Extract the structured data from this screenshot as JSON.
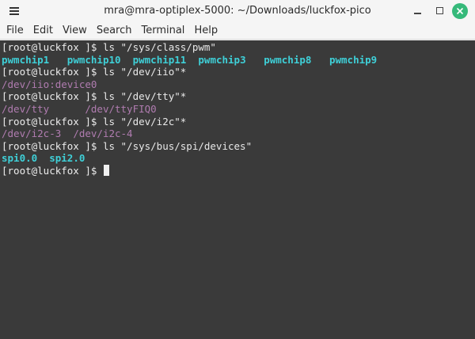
{
  "window": {
    "title": "mra@mra-optiplex-5000: ~/Downloads/luckfox-pico",
    "accent_close": "#35b97a"
  },
  "menu": {
    "items": [
      "File",
      "Edit",
      "View",
      "Search",
      "Terminal",
      "Help"
    ]
  },
  "terminal": {
    "prompt": "[root@luckfox ]$",
    "colors": {
      "background": "#3a3a3a",
      "text": "#e8e8e8",
      "directory": "#3fd0d8",
      "device": "#b07cb0"
    },
    "commands": [
      {
        "cmd": " ls \"/sys/class/pwm\"",
        "output_type": "dir",
        "output": [
          "pwmchip1",
          "pwmchip10",
          "pwmchip11",
          "pwmchip3",
          "pwmchip8",
          "pwmchip9"
        ]
      },
      {
        "cmd": " ls \"/dev/iio\"*",
        "output_type": "dev",
        "output": [
          "/dev/iio:device0"
        ]
      },
      {
        "cmd": " ls \"/dev/tty\"*",
        "output_type": "dev",
        "output": [
          "/dev/tty",
          "/dev/ttyFIQ0"
        ]
      },
      {
        "cmd": " ls \"/dev/i2c\"*",
        "output_type": "dev",
        "output": [
          "/dev/i2c-3",
          "/dev/i2c-4"
        ]
      },
      {
        "cmd": " ls \"/sys/bus/spi/devices\"",
        "output_type": "dir",
        "output": [
          "spi0.0",
          "spi2.0"
        ]
      }
    ],
    "final_prompt": "[root@luckfox ]$ "
  }
}
